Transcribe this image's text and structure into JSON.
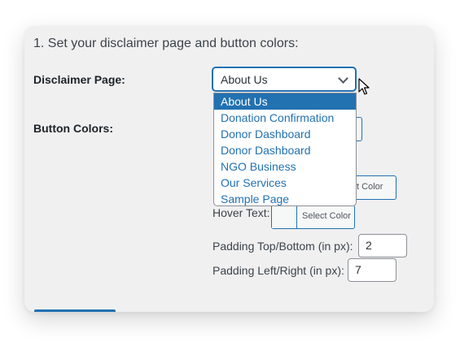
{
  "section": {
    "heading": "1. Set your disclaimer page and button colors:"
  },
  "disclaimer": {
    "label": "Disclaimer Page:",
    "selected": "About Us",
    "options": [
      "About Us",
      "Donation Confirmation",
      "Donor Dashboard",
      "Donor Dashboard",
      "NGO Business",
      "Our Services",
      "Sample Page"
    ]
  },
  "button_colors": {
    "label": "Button Colors:",
    "text_picker_label": "lect Color",
    "hover_text_label": "Hover Text:",
    "hover_picker_label": "Select Color",
    "padding_tb_label": "Padding Top/Bottom (in px):",
    "padding_tb_value": "2",
    "padding_lr_label": "Padding Left/Right (in px):",
    "padding_lr_value": "7"
  },
  "colors": {
    "accent": "#2271b1",
    "background": "#f0f0f1"
  }
}
